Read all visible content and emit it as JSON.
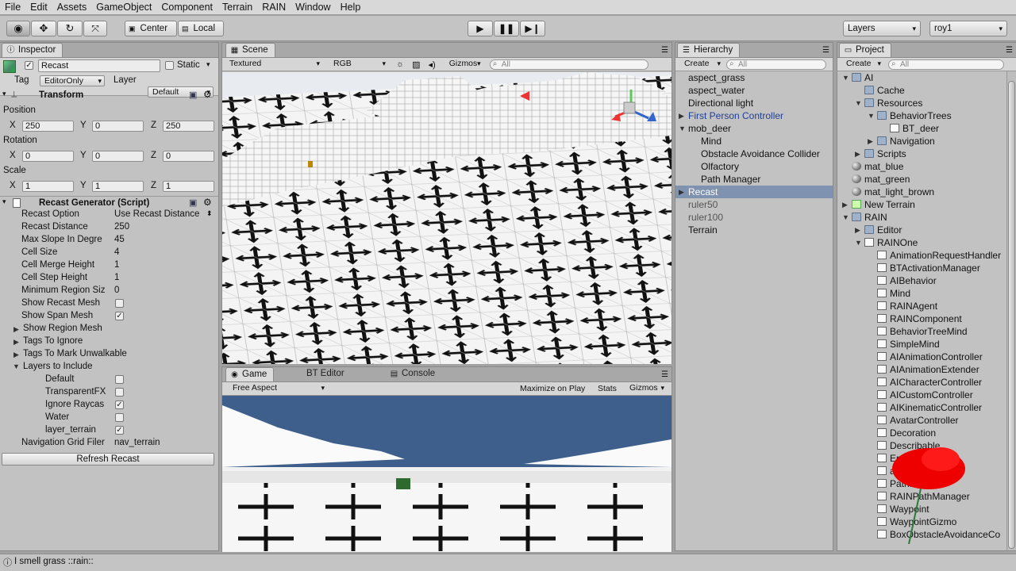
{
  "menu": [
    "File",
    "Edit",
    "Assets",
    "GameObject",
    "Component",
    "Terrain",
    "RAIN",
    "Window",
    "Help"
  ],
  "toolbar": {
    "pivot": "Center",
    "space": "Local",
    "layers": "Layers",
    "layout": "roy1"
  },
  "inspector": {
    "tab": "Inspector",
    "object_name": "Recast",
    "static_label": "Static",
    "tag_label": "Tag",
    "tag_value": "EditorOnly",
    "layer_label": "Layer",
    "layer_value": "Default",
    "transform": {
      "title": "Transform",
      "position_label": "Position",
      "rotation_label": "Rotation",
      "scale_label": "Scale",
      "x": "X",
      "y": "Y",
      "z": "Z",
      "position": [
        "250",
        "0",
        "250"
      ],
      "rotation": [
        "0",
        "0",
        "0"
      ],
      "scale": [
        "1",
        "1",
        "1"
      ]
    },
    "script": {
      "title": "Recast Generator (Script)",
      "rows": [
        {
          "label": "Recast Option",
          "value": "Use Recast Distance"
        },
        {
          "label": "Recast Distance",
          "value": "250"
        },
        {
          "label": "Max Slope In Degre",
          "value": "45"
        },
        {
          "label": "Cell Size",
          "value": "4"
        },
        {
          "label": "Cell Merge Height",
          "value": "1"
        },
        {
          "label": "Cell Step Height",
          "value": "1"
        },
        {
          "label": "Minimum Region Siz",
          "value": "0"
        }
      ],
      "show_recast_mesh": "Show Recast Mesh",
      "show_span_mesh": "Show Span Mesh",
      "show_region_mesh": "Show Region Mesh",
      "tags_to_ignore": "Tags To Ignore",
      "tags_unwalkable": "Tags To Mark Unwalkable",
      "layers_to_include": "Layers to Include",
      "layers": [
        {
          "name": "Default",
          "checked": false
        },
        {
          "name": "TransparentFX",
          "checked": false
        },
        {
          "name": "Ignore Raycas",
          "checked": true
        },
        {
          "name": "Water",
          "checked": false
        },
        {
          "name": "layer_terrain",
          "checked": true
        }
      ],
      "nav_grid_label": "Navigation Grid Filer",
      "nav_grid_value": "nav_terrain",
      "refresh_button": "Refresh Recast"
    }
  },
  "scene": {
    "tab": "Scene",
    "render_mode": "Textured",
    "color_mode": "RGB",
    "gizmos": "Gizmos",
    "search_placeholder": "All"
  },
  "game": {
    "tabs": [
      "Game",
      "BT Editor",
      "Console"
    ],
    "aspect": "Free Aspect",
    "maximize": "Maximize on Play",
    "stats": "Stats",
    "gizmos": "Gizmos"
  },
  "hierarchy": {
    "tab": "Hierarchy",
    "create": "Create",
    "search_placeholder": "All",
    "items": [
      {
        "label": "aspect_grass",
        "indent": 0,
        "fold": ""
      },
      {
        "label": "aspect_water",
        "indent": 0,
        "fold": ""
      },
      {
        "label": "Directional light",
        "indent": 0,
        "fold": ""
      },
      {
        "label": "First Person Controller",
        "indent": 0,
        "fold": "right",
        "color": "#1f3f9a"
      },
      {
        "label": "mob_deer",
        "indent": 0,
        "fold": "down"
      },
      {
        "label": "Mind",
        "indent": 1,
        "fold": ""
      },
      {
        "label": "Obstacle Avoidance Collider",
        "indent": 1,
        "fold": ""
      },
      {
        "label": "Olfactory",
        "indent": 1,
        "fold": ""
      },
      {
        "label": "Path Manager",
        "indent": 1,
        "fold": ""
      },
      {
        "label": "Recast",
        "indent": 0,
        "fold": "right",
        "selected": true
      },
      {
        "label": "ruler50",
        "indent": 0,
        "fold": "",
        "color": "#555"
      },
      {
        "label": "ruler100",
        "indent": 0,
        "fold": "",
        "color": "#555"
      },
      {
        "label": "Terrain",
        "indent": 0,
        "fold": ""
      }
    ]
  },
  "project": {
    "tab": "Project",
    "create": "Create",
    "search_placeholder": "All",
    "items": [
      {
        "label": "AI",
        "indent": 0,
        "fold": "down",
        "icon": "folder"
      },
      {
        "label": "Cache",
        "indent": 1,
        "fold": "",
        "icon": "folder"
      },
      {
        "label": "Resources",
        "indent": 1,
        "fold": "down",
        "icon": "folder"
      },
      {
        "label": "BehaviorTrees",
        "indent": 2,
        "fold": "down",
        "icon": "folder"
      },
      {
        "label": "BT_deer",
        "indent": 3,
        "fold": "",
        "icon": "script"
      },
      {
        "label": "Navigation",
        "indent": 2,
        "fold": "right",
        "icon": "folder"
      },
      {
        "label": "Scripts",
        "indent": 1,
        "fold": "right",
        "icon": "folder"
      },
      {
        "label": "mat_blue",
        "indent": 0,
        "fold": "",
        "icon": "sphere"
      },
      {
        "label": "mat_green",
        "indent": 0,
        "fold": "",
        "icon": "sphere"
      },
      {
        "label": "mat_light_brown",
        "indent": 0,
        "fold": "",
        "icon": "sphere"
      },
      {
        "label": "New Terrain",
        "indent": 0,
        "fold": "right",
        "icon": "terrain"
      },
      {
        "label": "RAIN",
        "indent": 0,
        "fold": "down",
        "icon": "folder"
      },
      {
        "label": "Editor",
        "indent": 1,
        "fold": "right",
        "icon": "folder"
      },
      {
        "label": "RAINOne",
        "indent": 1,
        "fold": "down",
        "icon": "script"
      },
      {
        "label": "AnimationRequestHandler",
        "indent": 2,
        "fold": "",
        "icon": "script"
      },
      {
        "label": "BTActivationManager",
        "indent": 2,
        "fold": "",
        "icon": "script"
      },
      {
        "label": "AIBehavior",
        "indent": 2,
        "fold": "",
        "icon": "script"
      },
      {
        "label": "Mind",
        "indent": 2,
        "fold": "",
        "icon": "script"
      },
      {
        "label": "RAINAgent",
        "indent": 2,
        "fold": "",
        "icon": "script"
      },
      {
        "label": "RAINComponent",
        "indent": 2,
        "fold": "",
        "icon": "script"
      },
      {
        "label": "BehaviorTreeMind",
        "indent": 2,
        "fold": "",
        "icon": "script"
      },
      {
        "label": "SimpleMind",
        "indent": 2,
        "fold": "",
        "icon": "script"
      },
      {
        "label": "AIAnimationController",
        "indent": 2,
        "fold": "",
        "icon": "script"
      },
      {
        "label": "AIAnimationExtender",
        "indent": 2,
        "fold": "",
        "icon": "script"
      },
      {
        "label": "AICharacterController",
        "indent": 2,
        "fold": "",
        "icon": "script"
      },
      {
        "label": "AICustomController",
        "indent": 2,
        "fold": "",
        "icon": "script"
      },
      {
        "label": "AIKinematicController",
        "indent": 2,
        "fold": "",
        "icon": "script"
      },
      {
        "label": "AvatarController",
        "indent": 2,
        "fold": "",
        "icon": "script"
      },
      {
        "label": "Decoration",
        "indent": 2,
        "fold": "",
        "icon": "script"
      },
      {
        "label": "Describable",
        "indent": 2,
        "fold": "",
        "icon": "script"
      },
      {
        "label": "Ent",
        "indent": 2,
        "fold": "",
        "icon": "script"
      },
      {
        "label": "ager",
        "indent": 2,
        "fold": "",
        "icon": "script"
      },
      {
        "label": "PathManager",
        "indent": 2,
        "fold": "",
        "icon": "script"
      },
      {
        "label": "RAINPathManager",
        "indent": 2,
        "fold": "",
        "icon": "script"
      },
      {
        "label": "Waypoint",
        "indent": 2,
        "fold": "",
        "icon": "script"
      },
      {
        "label": "WaypointGizmo",
        "indent": 2,
        "fold": "",
        "icon": "script"
      },
      {
        "label": "BoxObstacleAvoidanceCo",
        "indent": 2,
        "fold": "",
        "icon": "script"
      }
    ]
  },
  "status": {
    "message": "I smell grass ::rain::"
  },
  "colors": {
    "selection": "#7f92b0",
    "sky": "#3e5f8b",
    "panel": "#c2c2c2"
  }
}
